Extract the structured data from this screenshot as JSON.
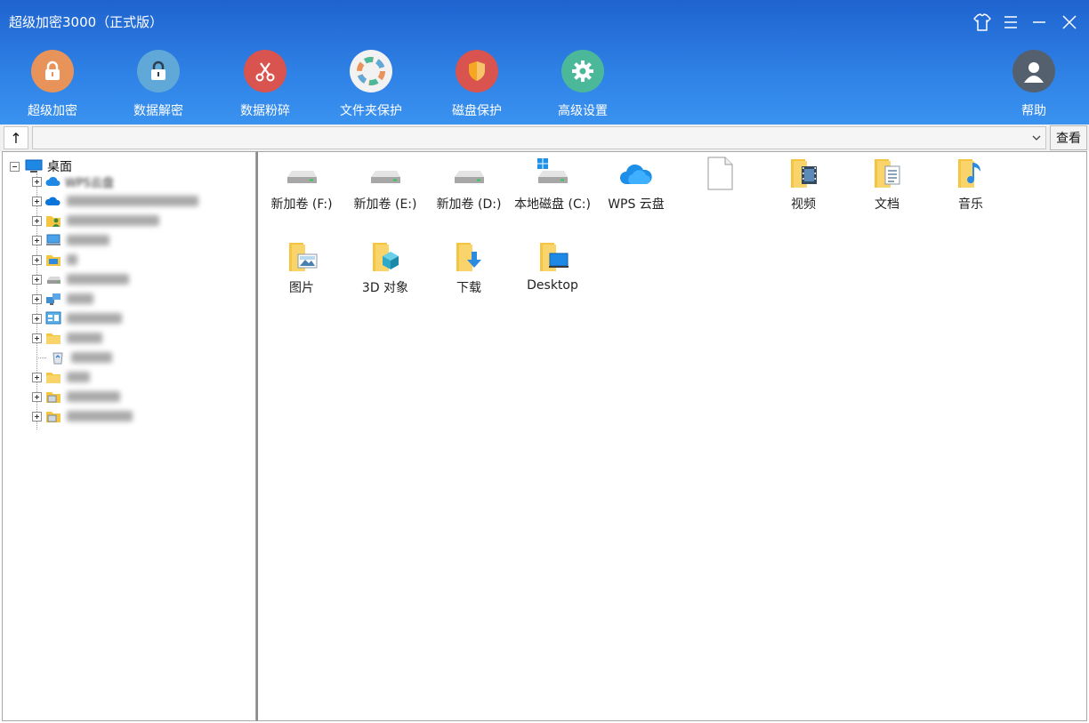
{
  "window": {
    "title": "超级加密3000（正式版）"
  },
  "toolbar": {
    "items": [
      {
        "label": "超级加密",
        "icon": "lock-icon",
        "color": "#e8935a"
      },
      {
        "label": "数据解密",
        "icon": "unlock-icon",
        "color": "#5fa8d8"
      },
      {
        "label": "数据粉碎",
        "icon": "scissors-icon",
        "color": "#d9534f"
      },
      {
        "label": "文件夹保护",
        "icon": "folder-protect-icon",
        "color": "#f2f2f2"
      },
      {
        "label": "磁盘保护",
        "icon": "shield-icon",
        "color": "#d9534f"
      },
      {
        "label": "高级设置",
        "icon": "gear-icon",
        "color": "#4cb89a"
      }
    ],
    "help": {
      "label": "帮助",
      "icon": "user-icon",
      "color": "#55606e"
    }
  },
  "address": {
    "up_label": "↑",
    "path": "",
    "view_label": "查看"
  },
  "tree": {
    "root": {
      "label": "桌面",
      "icon": "desktop-icon"
    },
    "items": [
      {
        "label": "WPS云盘",
        "icon": "cloud-icon",
        "expandable": true
      },
      {
        "label": "",
        "icon": "onedrive-icon",
        "expandable": true
      },
      {
        "label": "",
        "icon": "user-folder-icon",
        "expandable": true
      },
      {
        "label": "",
        "icon": "computer-icon",
        "expandable": true
      },
      {
        "label": "",
        "icon": "library-icon",
        "expandable": true
      },
      {
        "label": "",
        "icon": "drive-icon",
        "expandable": true
      },
      {
        "label": "",
        "icon": "network-icon",
        "expandable": true
      },
      {
        "label": "",
        "icon": "control-panel-icon",
        "expandable": true
      },
      {
        "label": "",
        "icon": "folder-icon",
        "expandable": true
      },
      {
        "label": "",
        "icon": "recycle-bin-icon",
        "expandable": false
      },
      {
        "label": "",
        "icon": "folder-icon",
        "expandable": true
      },
      {
        "label": "",
        "icon": "folder-doc-icon",
        "expandable": true
      },
      {
        "label": "",
        "icon": "folder-doc-icon",
        "expandable": true
      }
    ]
  },
  "files": [
    {
      "name": "新加卷 (F:)",
      "icon": "hard-drive-icon"
    },
    {
      "name": "新加卷 (E:)",
      "icon": "hard-drive-icon"
    },
    {
      "name": "新加卷 (D:)",
      "icon": "hard-drive-icon"
    },
    {
      "name": "本地磁盘 (C:)",
      "icon": "system-drive-icon"
    },
    {
      "name": "WPS 云盘",
      "icon": "wps-cloud-icon"
    },
    {
      "name": "",
      "icon": "blank-file-icon"
    },
    {
      "name": "视频",
      "icon": "videos-folder-icon"
    },
    {
      "name": "文档",
      "icon": "documents-folder-icon"
    },
    {
      "name": "音乐",
      "icon": "music-folder-icon"
    },
    {
      "name": "图片",
      "icon": "pictures-folder-icon"
    },
    {
      "name": "3D 对象",
      "icon": "3d-objects-folder-icon"
    },
    {
      "name": "下载",
      "icon": "downloads-folder-icon"
    },
    {
      "name": "Desktop",
      "icon": "desktop-folder-icon"
    }
  ]
}
